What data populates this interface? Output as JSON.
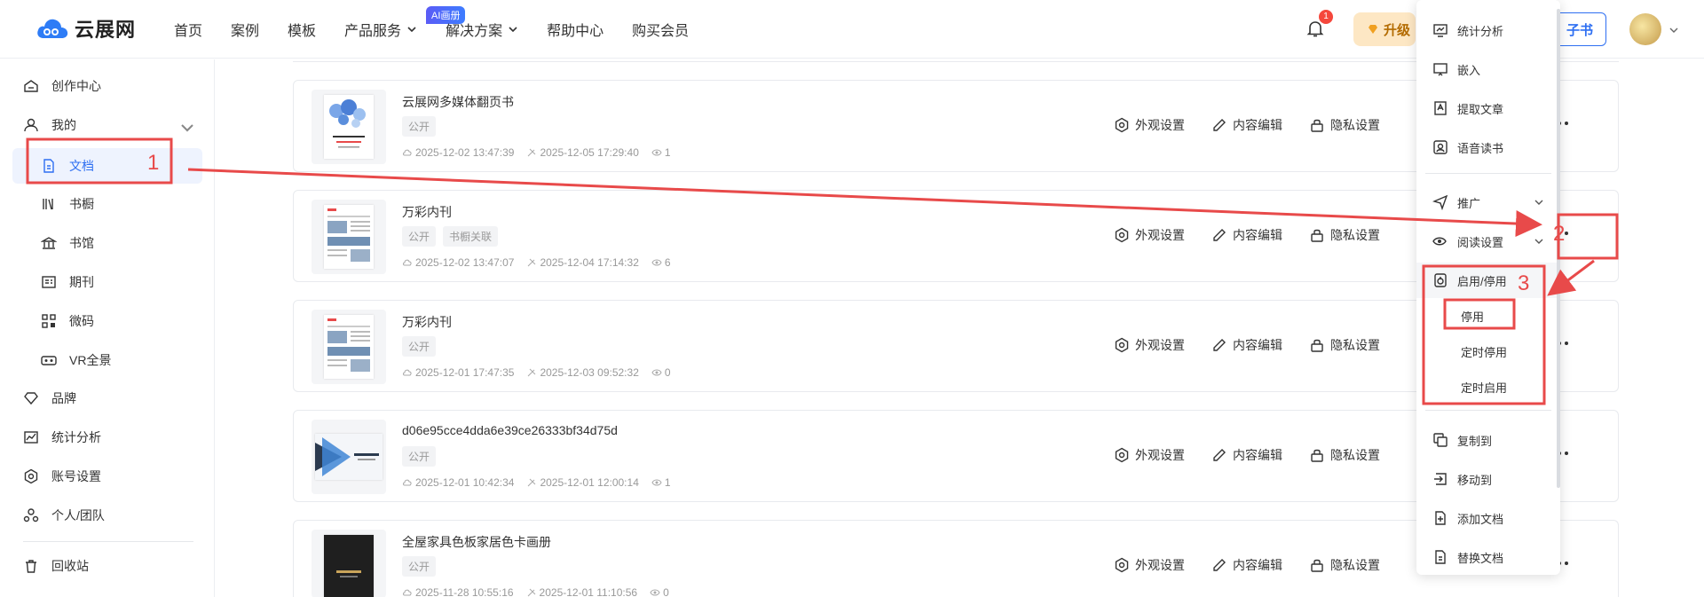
{
  "header": {
    "logo_text": "云展网",
    "nav": [
      "首页",
      "案例",
      "模板",
      "产品服务",
      "解决方案",
      "帮助中心",
      "购买会员"
    ],
    "ai_badge": "AI画册",
    "notification_count": "1",
    "upgrade_label": "升级",
    "create_label": "子书"
  },
  "sidebar": {
    "items": [
      {
        "label": "创作中心",
        "icon": "home-icon"
      },
      {
        "label": "我的",
        "icon": "user-icon"
      },
      {
        "label": "文档",
        "icon": "document-icon"
      },
      {
        "label": "书橱",
        "icon": "bookshelf-icon"
      },
      {
        "label": "书馆",
        "icon": "library-icon"
      },
      {
        "label": "期刊",
        "icon": "periodical-icon"
      },
      {
        "label": "微码",
        "icon": "qrcode-icon"
      },
      {
        "label": "VR全景",
        "icon": "vr-icon"
      },
      {
        "label": "品牌",
        "icon": "diamond-icon"
      },
      {
        "label": "统计分析",
        "icon": "chart-icon"
      },
      {
        "label": "账号设置",
        "icon": "settings-icon"
      },
      {
        "label": "个人/团队",
        "icon": "team-icon"
      },
      {
        "label": "回收站",
        "icon": "trash-icon"
      }
    ]
  },
  "docs": [
    {
      "title": "云展网多媒体翻页书",
      "tags": [
        "公开"
      ],
      "created": "2025-12-02 13:47:39",
      "updated": "2025-12-05 17:29:40",
      "views": "1"
    },
    {
      "title": "万彩内刊",
      "tags": [
        "公开",
        "书橱关联"
      ],
      "created": "2025-12-02 13:47:07",
      "updated": "2025-12-04 17:14:32",
      "views": "6"
    },
    {
      "title": "万彩内刊",
      "tags": [
        "公开"
      ],
      "created": "2025-12-01 17:47:35",
      "updated": "2025-12-03 09:52:32",
      "views": "0"
    },
    {
      "title": "d06e95cce4dda6e39ce26333bf34d75d",
      "tags": [
        "公开"
      ],
      "created": "2025-12-01 10:42:34",
      "updated": "2025-12-01 12:00:14",
      "views": "1"
    },
    {
      "title": "全屋家具色板家居色卡画册",
      "tags": [
        "公开"
      ],
      "created": "2025-11-28 10:55:16",
      "updated": "2025-12-01 11:10:56",
      "views": "0"
    }
  ],
  "actions": {
    "appearance": "外观设置",
    "content": "内容编辑",
    "privacy": "隐私设置"
  },
  "menu": {
    "stats": "统计分析",
    "embed": "嵌入",
    "extract": "提取文章",
    "voice": "语音读书",
    "promote": "推广",
    "reading": "阅读设置",
    "enable_disable": "启用/停用",
    "disable": "停用",
    "timed_disable": "定时停用",
    "timed_enable": "定时启用",
    "copy_to": "复制到",
    "move_to": "移动到",
    "add_doc": "添加文档",
    "replace_doc": "替换文档"
  },
  "annotations": {
    "step1": "1",
    "step2": "2",
    "step3": "3"
  },
  "colors": {
    "accent": "#2e6ff2",
    "annotation": "#e84a4a"
  }
}
